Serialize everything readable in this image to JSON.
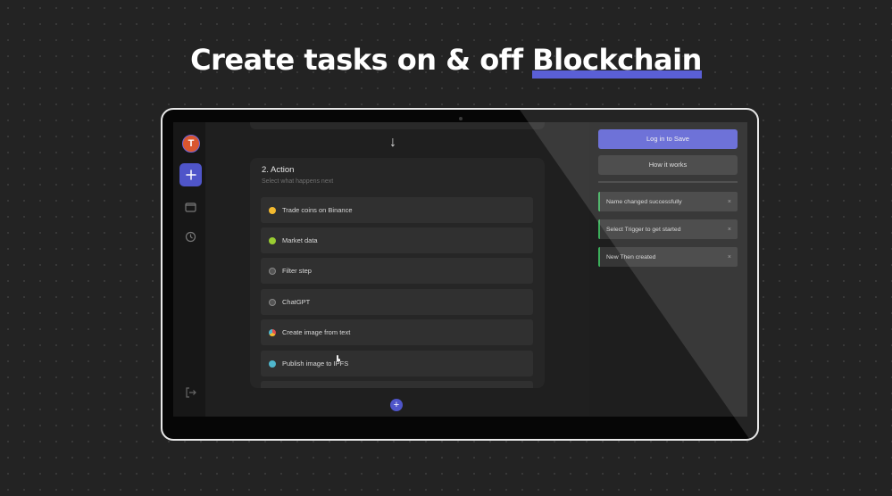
{
  "headline": {
    "prefix": "Create tasks on & off",
    "highlight": "Blockchain"
  },
  "sidebar": {
    "avatar_letter": "T",
    "items": [
      {
        "icon": "plus-icon",
        "active": true
      },
      {
        "icon": "folder-icon",
        "active": false
      },
      {
        "icon": "history-icon",
        "active": false
      },
      {
        "icon": "logout-icon",
        "active": false
      }
    ]
  },
  "canvas": {
    "arrow": "↓",
    "action_panel": {
      "title": "2. Action",
      "subtitle": "Select what happens next",
      "items": [
        {
          "label": "Trade coins on Binance",
          "icon": "binance-icon",
          "color": "#f3ba2f"
        },
        {
          "label": "Market data",
          "icon": "market-data-icon",
          "color": "#9acd32"
        },
        {
          "label": "Filter step",
          "icon": "filter-icon",
          "color": "#555555"
        },
        {
          "label": "ChatGPT",
          "icon": "chatgpt-icon",
          "color": "#555555"
        },
        {
          "label": "Create image from text",
          "icon": "image-gen-icon",
          "color": "#e0504f"
        },
        {
          "label": "Publish image to IPFS",
          "icon": "ipfs-icon",
          "color": "#4fb6cc"
        }
      ]
    },
    "add_label": "+"
  },
  "right_panel": {
    "login_label": "Log in to Save",
    "how_label": "How it works",
    "toasts": [
      {
        "text": "Name changed successfully",
        "close": "×"
      },
      {
        "text": "Select Trigger to get started",
        "close": "×"
      },
      {
        "text": "New Then created",
        "close": "×"
      }
    ]
  },
  "colors": {
    "accent": "#5b5fd3",
    "toast_border": "#3cae5b",
    "background": "#232323"
  }
}
